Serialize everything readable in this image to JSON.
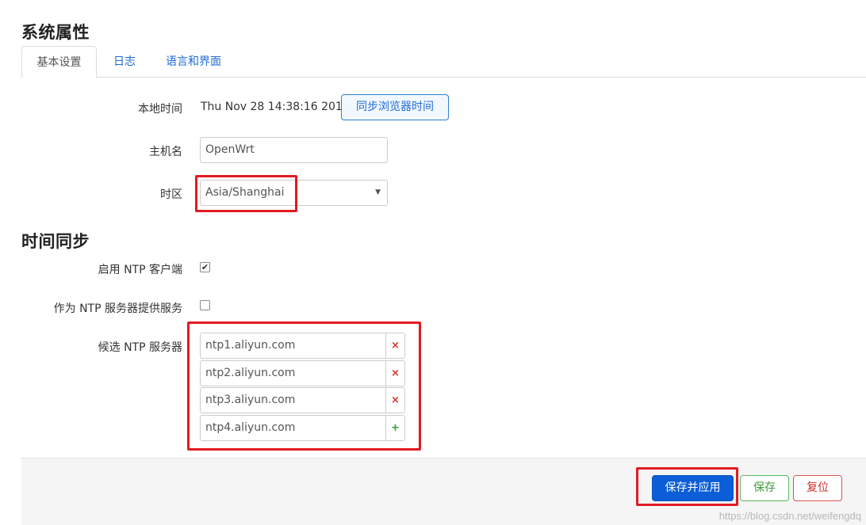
{
  "page_title": "系统属性",
  "tabs": [
    {
      "label": "基本设置",
      "active": true
    },
    {
      "label": "日志",
      "active": false
    },
    {
      "label": "语言和界面",
      "active": false
    }
  ],
  "basic": {
    "local_time_label": "本地时间",
    "local_time_value": "Thu Nov 28 14:38:16 2019",
    "sync_button": "同步浏览器时间",
    "hostname_label": "主机名",
    "hostname_value": "OpenWrt",
    "timezone_label": "时区",
    "timezone_value": "Asia/Shanghai"
  },
  "ntp_section_title": "时间同步",
  "ntp": {
    "enable_client_label": "启用 NTP 客户端",
    "enable_client_checked": true,
    "serve_label": "作为 NTP 服务器提供服务",
    "serve_checked": false,
    "candidates_label": "候选 NTP 服务器",
    "servers": [
      "ntp1.aliyun.com",
      "ntp2.aliyun.com",
      "ntp3.aliyun.com",
      "ntp4.aliyun.com"
    ],
    "remove_symbol": "×",
    "add_symbol": "+"
  },
  "footer": {
    "save_apply": "保存并应用",
    "save": "保存",
    "reset": "复位"
  },
  "watermark": "https://blog.csdn.net/weifengdq",
  "colors": {
    "highlight": "#e11b22",
    "primary": "#0b5ed7",
    "link": "#1e6bd6"
  },
  "icons": {
    "dropdown": "chevron-down-icon",
    "checkbox_checked": "check-icon",
    "remove": "close-icon",
    "add": "plus-icon"
  }
}
